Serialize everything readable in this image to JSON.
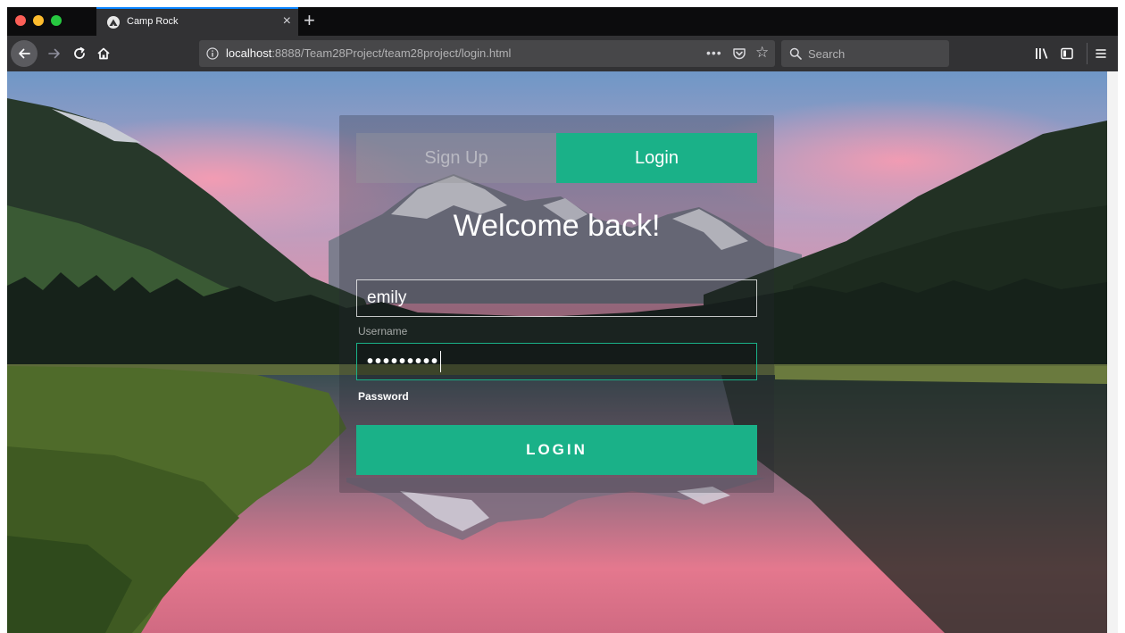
{
  "browser": {
    "tab": {
      "title": "Camp Rock",
      "close_glyph": "×"
    },
    "new_tab_glyph": "+",
    "url": {
      "host": "localhost",
      "path": ":8888/Team28Project/team28project/login.html"
    },
    "page_actions_glyph": "•••",
    "bookmark_glyph": "☆",
    "search_placeholder": "Search",
    "icons": [
      "back-icon",
      "forward-icon",
      "reload-icon",
      "home-icon",
      "info-icon",
      "pocket-icon",
      "star-icon",
      "search-icon",
      "library-icon",
      "sidebar-icon",
      "menu-icon"
    ]
  },
  "login_form": {
    "tabs": {
      "signup": "Sign Up",
      "login": "Login"
    },
    "title": "Welcome back!",
    "username": {
      "value": "emily",
      "label": "Username"
    },
    "password": {
      "masked_value": "•••••••••",
      "label": "Password"
    },
    "submit_label": "LOGIN"
  },
  "colors": {
    "accent": "#1ab188",
    "tab_active_line": "#0a84ff",
    "traffic_red": "#fc5f57",
    "traffic_yellow": "#fdbc2e",
    "traffic_green": "#27c840"
  }
}
